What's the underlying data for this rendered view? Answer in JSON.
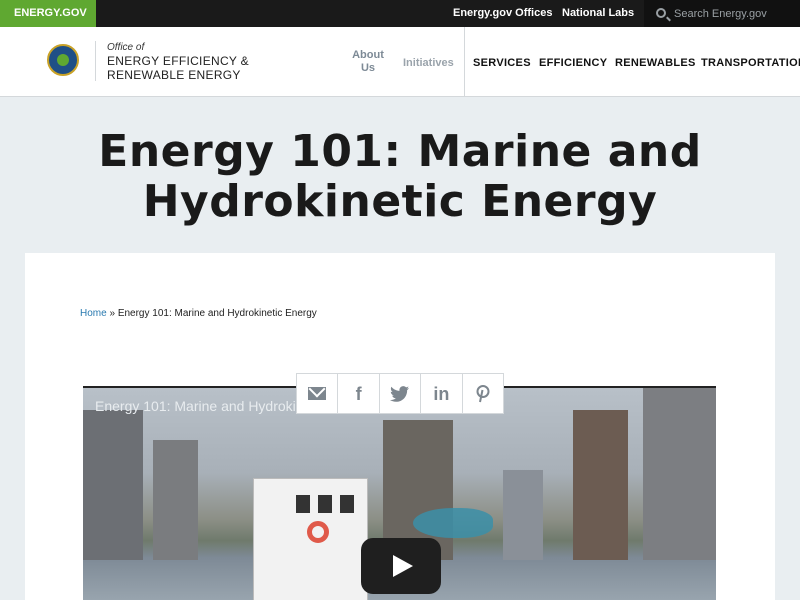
{
  "topbar": {
    "brand": "ENERGY.GOV",
    "links": [
      "Energy.gov Offices",
      "National Labs"
    ],
    "search_placeholder": "Search Energy.gov"
  },
  "header": {
    "office_of": "Office of",
    "office_name": "ENERGY EFFICIENCY & RENEWABLE ENERGY",
    "nav_secondary": [
      "About Us",
      "Initiatives"
    ],
    "nav_primary": [
      "SERVICES",
      "EFFICIENCY",
      "RENEWABLES",
      "TRANSPORTATION"
    ]
  },
  "page": {
    "title": "Energy 101: Marine and Hydrokinetic Energy"
  },
  "breadcrumb": {
    "home": "Home",
    "separator": "»",
    "current": "Energy 101: Marine and Hydrokinetic Energy"
  },
  "video": {
    "title": "Energy 101: Marine and Hydrokin",
    "play_icon": "play-icon"
  },
  "share": {
    "icons": [
      "email-icon",
      "facebook-icon",
      "twitter-icon",
      "linkedin-icon",
      "pinterest-icon"
    ]
  },
  "colors": {
    "brand_green": "#5fa831",
    "topbar_bg": "#1a1a1a",
    "page_bg": "#e9eef1",
    "link_blue": "#2a7ab0"
  }
}
